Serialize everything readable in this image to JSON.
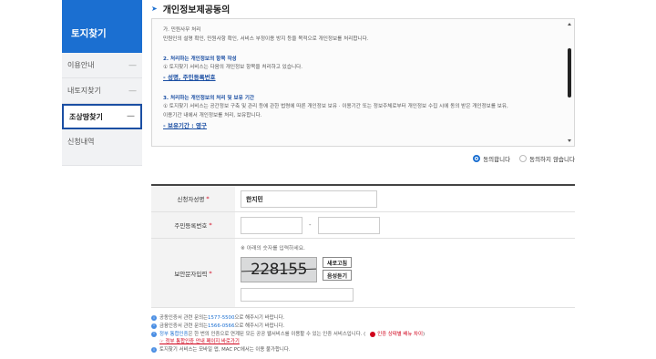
{
  "sidebar": {
    "title": "토지찾기",
    "items": [
      {
        "label": "이용안내",
        "dash": "—"
      },
      {
        "label": "내토지찾기",
        "dash": "—"
      },
      {
        "label": "조상땅찾기",
        "dash": "—"
      },
      {
        "label": "신청내역",
        "dash": ""
      }
    ]
  },
  "section": {
    "title": "개인정보제공동의"
  },
  "terms": {
    "s1_line1": "가. 민원사무 처리",
    "s1_line2": "민원인의 설명 확인, 민원사항 확인, 서비스 부정이용 방지 등을 목적으로 개인정보를 처리합니다.",
    "s2_title": "2. 처리하는 개인정보의 항목 작성",
    "s2_line1": "① 토지찾기 서비스는 다음의 개인정보 항목을 처리하고 있습니다.",
    "s2_link": "- 성명, 주민등록번호",
    "s3_title": "3. 처리하는 개인정보의 처리 및 보유 기간",
    "s3_line1": "① 토지찾기 서비스는 공간정보 구축 및 관리 등에 관한 법령에 따른 개인정보 보유 · 이용기간 또는 정보주체로부터 개인정보 수집 시에 동의 받은 개인정보를 보유,",
    "s3_line2": "이용기간 내에서 개인정보를 처리, 보유합니다.",
    "s3_link": "- 보유기간 : 영구"
  },
  "consent": {
    "agree_label": "동의합니다",
    "disagree_label": "동의하지 않습니다"
  },
  "form": {
    "name_label": "신청자성명",
    "name_value": "한지민",
    "rrn_label": "주민등록번호",
    "rrn_front": "",
    "rrn_back": "",
    "rrn_sep": "-",
    "captcha_label": "보안문자입력",
    "captcha_hint": "※ 아래의 숫자를 입력하세요.",
    "captcha_text": "228155",
    "refresh_label": "새로고침",
    "audio_label": "음성듣기",
    "captcha_input": "",
    "required_mark": "*"
  },
  "notes": {
    "n1_pre": "공동인증서 관련 문의는 ",
    "n1_phone": "1577-5500",
    "n1_post": " 으로 해주시기 바랍니다.",
    "n2_pre": "금융인증서 관련 문의는 ",
    "n2_phone": "1566-0566",
    "n2_post": " 으로 해주시기 바랍니다.",
    "n3_pre": "정부 통합인증",
    "n3_post": "은 한 번의 인증으로 연계된 모든 공공 웹서비스를 이용할 수 있는 인증 서비스입니다. (",
    "n3_badge": "인증 상태별 배뉴 차이",
    "n3_close": ")",
    "n4_link": "☞ 정부 통합인증 안내 페이지 바로가기",
    "n5": "토지찾기 서비스는 모바일 앱, MAC PC에서는 이용 불가합니다."
  }
}
